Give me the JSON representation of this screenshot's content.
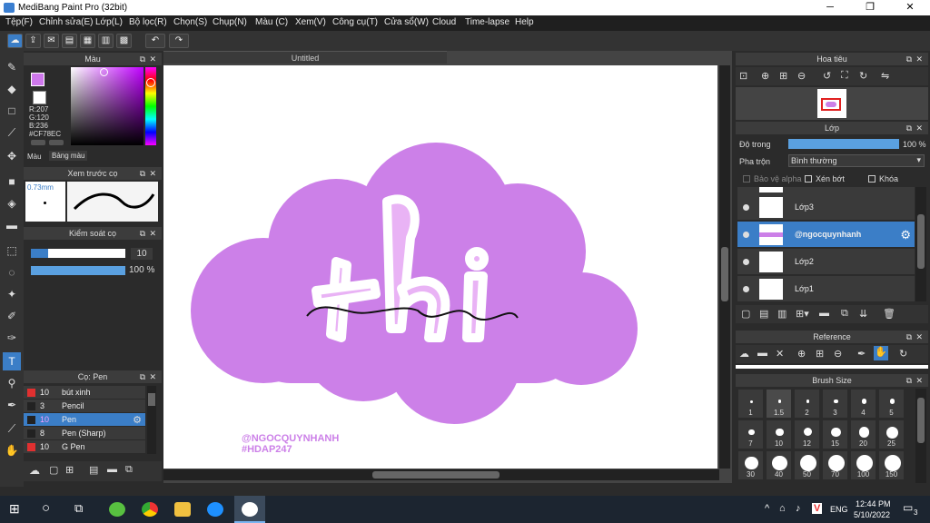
{
  "window": {
    "title": "MediBang Paint Pro (32bit)",
    "minimize": "─",
    "maximize": "❐",
    "close": "✕"
  },
  "menu": [
    "Tệp(F)",
    "Chỉnh sửa(E)",
    "Lớp(L)",
    "Bộ lọc(R)",
    "Chọn(S)",
    "Chụp(N)",
    "Màu (C)",
    "Xem(V)",
    "Công cụ(T)",
    "Cửa sổ(W)",
    "Cloud",
    "Time-lapse",
    "Help"
  ],
  "color_panel": {
    "title": "Màu",
    "r": "R:207",
    "g": "G:120",
    "b": "B:236",
    "hex": "#CF78EC",
    "tabs": [
      "Màu",
      "Bảng màu"
    ],
    "accent": "#cf78ec"
  },
  "preview_panel": {
    "title": "Xem trước cọ",
    "size": "0.73mm"
  },
  "brush_control": {
    "title": "Kiểm soát cọ",
    "size": "10",
    "opacity": "100 %",
    "size_fraction": 0.1,
    "opacity_fraction": 1.0
  },
  "brush_list": {
    "title": "Cọ: Pen",
    "items": [
      {
        "size": "10",
        "name": "bút xinh",
        "color": "#e03030"
      },
      {
        "size": "3",
        "name": "Pencil",
        "color": "#222222"
      },
      {
        "size": "10",
        "name": "Pen",
        "color": "#222222",
        "selected": true
      },
      {
        "size": "8",
        "name": "Pen (Sharp)",
        "color": "#222222"
      },
      {
        "size": "10",
        "name": "G Pen",
        "color": "#e03030"
      }
    ]
  },
  "canvas": {
    "tab": "Untitled",
    "art_text": "thi",
    "watermark1": "@NGOCQUYNHANH",
    "watermark2": "#HDAP247",
    "cloud_color": "#cc80e8",
    "letter_color": "#e9b3f5"
  },
  "navigator": {
    "title": "Hoa tiêu"
  },
  "layer_panel": {
    "title": "Lớp",
    "opacity_label": "Độ trong",
    "opacity_value": "100 %",
    "opacity_fraction": 1.0,
    "blend_label": "Pha trộn",
    "blend_value": "Bình thường",
    "protect_alpha": "Bảo vệ alpha",
    "clip": "Xén bớt",
    "lock": "Khóa",
    "layers": [
      {
        "name": "Lớp3"
      },
      {
        "name": "@ngocquynhanh",
        "selected": true
      },
      {
        "name": "Lớp2"
      },
      {
        "name": "Lớp1"
      }
    ]
  },
  "reference_panel": {
    "title": "Reference"
  },
  "brush_size_panel": {
    "title": "Brush Size",
    "sizes": [
      "1",
      "1.5",
      "2",
      "3",
      "4",
      "5",
      "7",
      "10",
      "12",
      "15",
      "20",
      "25",
      "30",
      "40",
      "50",
      "70",
      "100",
      "150"
    ]
  },
  "taskbar": {
    "time": "12:44 PM",
    "date": "5/10/2022",
    "lang": "ENG",
    "notif": "3"
  }
}
